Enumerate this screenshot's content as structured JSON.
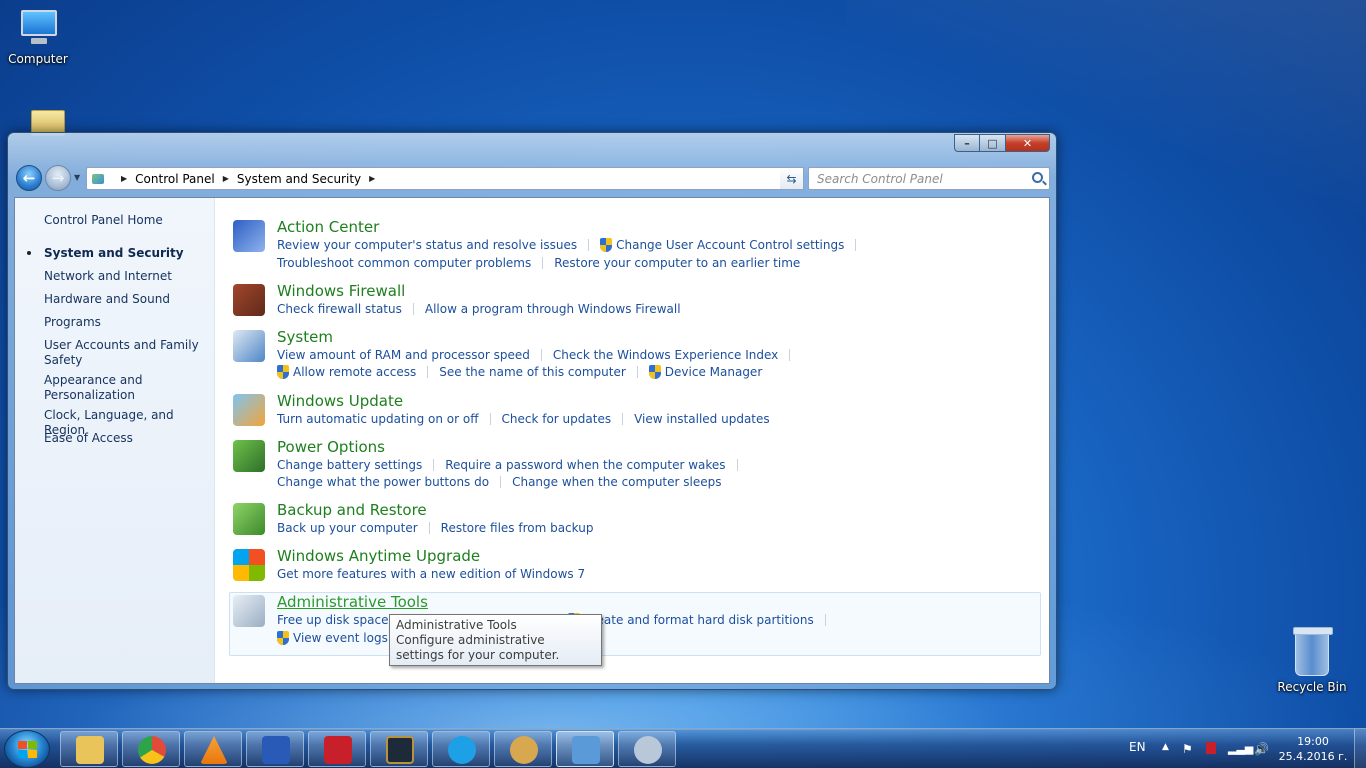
{
  "desktop": {
    "icons": [
      {
        "label": "Computer"
      },
      {
        "label": ""
      },
      {
        "label": "Recycle Bin"
      }
    ]
  },
  "window": {
    "caption_buttons": {
      "minimize": "–",
      "maximize": "□",
      "close": "✕"
    },
    "breadcrumb": [
      "Control Panel",
      "System and Security"
    ],
    "search_placeholder": "Search Control Panel"
  },
  "sidebar": {
    "home": "Control Panel Home",
    "items": [
      {
        "label": "System and Security",
        "current": true
      },
      {
        "label": "Network and Internet"
      },
      {
        "label": "Hardware and Sound"
      },
      {
        "label": "Programs"
      },
      {
        "label": "User Accounts and Family Safety"
      },
      {
        "label": "Appearance and Personalization"
      },
      {
        "label": "Clock, Language, and Region"
      },
      {
        "label": "Ease of Access"
      }
    ]
  },
  "categories": [
    {
      "title": "Action Center",
      "links": [
        [
          "Review your computer's status and resolve issues",
          "Change User Account Control settings"
        ],
        [
          "Troubleshoot common computer problems",
          "Restore your computer to an earlier time"
        ]
      ]
    },
    {
      "title": "Windows Firewall",
      "links": [
        [
          "Check firewall status",
          "Allow a program through Windows Firewall"
        ]
      ]
    },
    {
      "title": "System",
      "links": [
        [
          "View amount of RAM and processor speed",
          "Check the Windows Experience Index"
        ],
        [
          "Allow remote access",
          "See the name of this computer",
          "Device Manager"
        ]
      ]
    },
    {
      "title": "Windows Update",
      "links": [
        [
          "Turn automatic updating on or off",
          "Check for updates",
          "View installed updates"
        ]
      ]
    },
    {
      "title": "Power Options",
      "links": [
        [
          "Change battery settings",
          "Require a password when the computer wakes"
        ],
        [
          "Change what the power buttons do",
          "Change when the computer sleeps"
        ]
      ]
    },
    {
      "title": "Backup and Restore",
      "links": [
        [
          "Back up your computer",
          "Restore files from backup"
        ]
      ]
    },
    {
      "title": "Windows Anytime Upgrade",
      "links": [
        [
          "Get more features with a new edition of Windows 7"
        ]
      ]
    },
    {
      "title": "Administrative Tools",
      "links": [
        [
          "Free up disk space",
          "Create and format hard disk partitions"
        ],
        [
          "View event logs"
        ]
      ]
    }
  ],
  "tooltip": {
    "title": "Administrative Tools",
    "text": "Configure administrative settings for your computer."
  },
  "taskbar": {
    "apps": [
      {
        "icon": "explorer-icon",
        "color": "#e8c45a"
      },
      {
        "icon": "chrome-icon",
        "color": "#e24a3a"
      },
      {
        "icon": "vlc-icon",
        "color": "#f08a12"
      },
      {
        "icon": "word-icon",
        "color": "#2a5ab8"
      },
      {
        "icon": "ccleaner-icon",
        "color": "#c8202a"
      },
      {
        "icon": "league-icon",
        "color": "#b8933a"
      },
      {
        "icon": "skype-icon",
        "color": "#1ea0e6"
      },
      {
        "icon": "paint-icon",
        "color": "#d8a850"
      },
      {
        "icon": "control-panel-icon",
        "color": "#5a9ad8"
      },
      {
        "icon": "snipping-tool-icon",
        "color": "#b8c8d8"
      }
    ],
    "language": "EN",
    "time": "19:00",
    "date": "25.4.2016 г."
  }
}
